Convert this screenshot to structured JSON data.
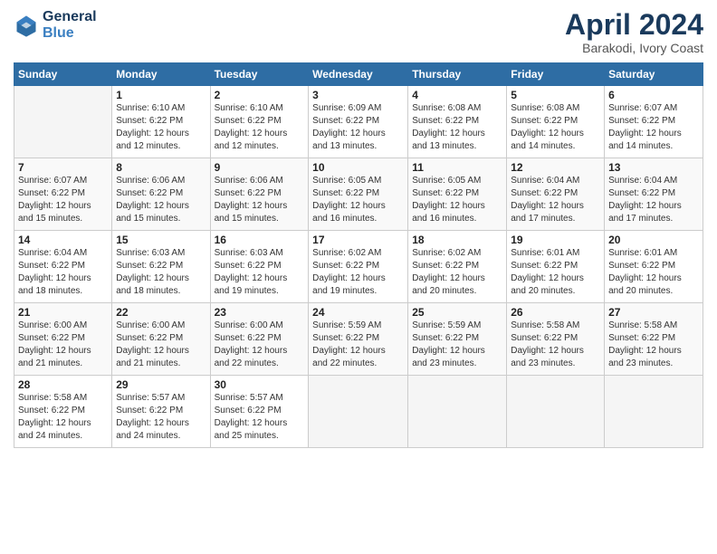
{
  "header": {
    "logo_line1": "General",
    "logo_line2": "Blue",
    "title": "April 2024",
    "subtitle": "Barakodi, Ivory Coast"
  },
  "columns": [
    "Sunday",
    "Monday",
    "Tuesday",
    "Wednesday",
    "Thursday",
    "Friday",
    "Saturday"
  ],
  "weeks": [
    [
      {
        "day": "",
        "info": ""
      },
      {
        "day": "1",
        "info": "Sunrise: 6:10 AM\nSunset: 6:22 PM\nDaylight: 12 hours\nand 12 minutes."
      },
      {
        "day": "2",
        "info": "Sunrise: 6:10 AM\nSunset: 6:22 PM\nDaylight: 12 hours\nand 12 minutes."
      },
      {
        "day": "3",
        "info": "Sunrise: 6:09 AM\nSunset: 6:22 PM\nDaylight: 12 hours\nand 13 minutes."
      },
      {
        "day": "4",
        "info": "Sunrise: 6:08 AM\nSunset: 6:22 PM\nDaylight: 12 hours\nand 13 minutes."
      },
      {
        "day": "5",
        "info": "Sunrise: 6:08 AM\nSunset: 6:22 PM\nDaylight: 12 hours\nand 14 minutes."
      },
      {
        "day": "6",
        "info": "Sunrise: 6:07 AM\nSunset: 6:22 PM\nDaylight: 12 hours\nand 14 minutes."
      }
    ],
    [
      {
        "day": "7",
        "info": "Sunrise: 6:07 AM\nSunset: 6:22 PM\nDaylight: 12 hours\nand 15 minutes."
      },
      {
        "day": "8",
        "info": "Sunrise: 6:06 AM\nSunset: 6:22 PM\nDaylight: 12 hours\nand 15 minutes."
      },
      {
        "day": "9",
        "info": "Sunrise: 6:06 AM\nSunset: 6:22 PM\nDaylight: 12 hours\nand 15 minutes."
      },
      {
        "day": "10",
        "info": "Sunrise: 6:05 AM\nSunset: 6:22 PM\nDaylight: 12 hours\nand 16 minutes."
      },
      {
        "day": "11",
        "info": "Sunrise: 6:05 AM\nSunset: 6:22 PM\nDaylight: 12 hours\nand 16 minutes."
      },
      {
        "day": "12",
        "info": "Sunrise: 6:04 AM\nSunset: 6:22 PM\nDaylight: 12 hours\nand 17 minutes."
      },
      {
        "day": "13",
        "info": "Sunrise: 6:04 AM\nSunset: 6:22 PM\nDaylight: 12 hours\nand 17 minutes."
      }
    ],
    [
      {
        "day": "14",
        "info": "Sunrise: 6:04 AM\nSunset: 6:22 PM\nDaylight: 12 hours\nand 18 minutes."
      },
      {
        "day": "15",
        "info": "Sunrise: 6:03 AM\nSunset: 6:22 PM\nDaylight: 12 hours\nand 18 minutes."
      },
      {
        "day": "16",
        "info": "Sunrise: 6:03 AM\nSunset: 6:22 PM\nDaylight: 12 hours\nand 19 minutes."
      },
      {
        "day": "17",
        "info": "Sunrise: 6:02 AM\nSunset: 6:22 PM\nDaylight: 12 hours\nand 19 minutes."
      },
      {
        "day": "18",
        "info": "Sunrise: 6:02 AM\nSunset: 6:22 PM\nDaylight: 12 hours\nand 20 minutes."
      },
      {
        "day": "19",
        "info": "Sunrise: 6:01 AM\nSunset: 6:22 PM\nDaylight: 12 hours\nand 20 minutes."
      },
      {
        "day": "20",
        "info": "Sunrise: 6:01 AM\nSunset: 6:22 PM\nDaylight: 12 hours\nand 20 minutes."
      }
    ],
    [
      {
        "day": "21",
        "info": "Sunrise: 6:00 AM\nSunset: 6:22 PM\nDaylight: 12 hours\nand 21 minutes."
      },
      {
        "day": "22",
        "info": "Sunrise: 6:00 AM\nSunset: 6:22 PM\nDaylight: 12 hours\nand 21 minutes."
      },
      {
        "day": "23",
        "info": "Sunrise: 6:00 AM\nSunset: 6:22 PM\nDaylight: 12 hours\nand 22 minutes."
      },
      {
        "day": "24",
        "info": "Sunrise: 5:59 AM\nSunset: 6:22 PM\nDaylight: 12 hours\nand 22 minutes."
      },
      {
        "day": "25",
        "info": "Sunrise: 5:59 AM\nSunset: 6:22 PM\nDaylight: 12 hours\nand 23 minutes."
      },
      {
        "day": "26",
        "info": "Sunrise: 5:58 AM\nSunset: 6:22 PM\nDaylight: 12 hours\nand 23 minutes."
      },
      {
        "day": "27",
        "info": "Sunrise: 5:58 AM\nSunset: 6:22 PM\nDaylight: 12 hours\nand 23 minutes."
      }
    ],
    [
      {
        "day": "28",
        "info": "Sunrise: 5:58 AM\nSunset: 6:22 PM\nDaylight: 12 hours\nand 24 minutes."
      },
      {
        "day": "29",
        "info": "Sunrise: 5:57 AM\nSunset: 6:22 PM\nDaylight: 12 hours\nand 24 minutes."
      },
      {
        "day": "30",
        "info": "Sunrise: 5:57 AM\nSunset: 6:22 PM\nDaylight: 12 hours\nand 25 minutes."
      },
      {
        "day": "",
        "info": ""
      },
      {
        "day": "",
        "info": ""
      },
      {
        "day": "",
        "info": ""
      },
      {
        "day": "",
        "info": ""
      }
    ]
  ]
}
